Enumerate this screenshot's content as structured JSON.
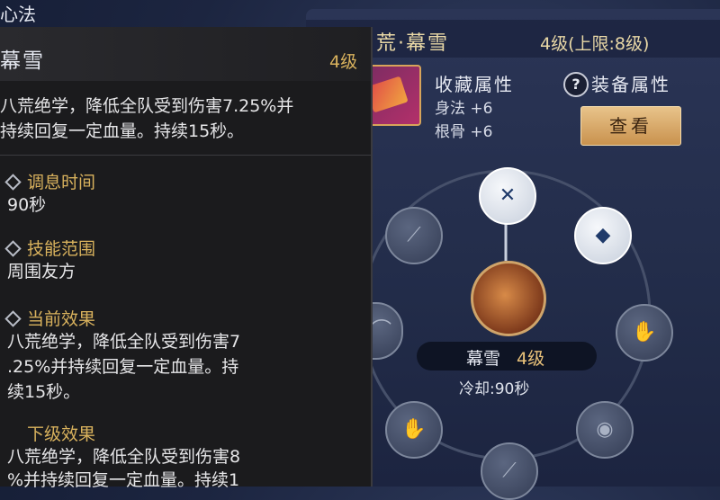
{
  "top_label": "心法",
  "tooltip": {
    "title": "幕雪",
    "level": "4级",
    "description_lines": [
      "八荒绝学，降低全队受到伤害7.25%并",
      "持续回复一定血量。持续15秒。"
    ],
    "sections": [
      {
        "label": "调息时间",
        "value_lines": [
          "90秒"
        ]
      },
      {
        "label": "技能范围",
        "value_lines": [
          "周围友方"
        ]
      },
      {
        "label": "当前效果",
        "value_lines": [
          "八荒绝学，降低全队受到伤害7",
          ".25%并持续回复一定血量。持",
          "续15秒。"
        ]
      },
      {
        "label": "下级效果",
        "value_lines": [
          "八荒绝学，降低全队受到伤害8",
          "%并持续回复一定血量。持续1"
        ]
      }
    ]
  },
  "panel": {
    "title": "荒·幕雪",
    "level": "4级(上限:8级)",
    "collect_title": "收藏属性",
    "stats": [
      "身法 +6",
      "根骨 +6"
    ],
    "help_icon": "?",
    "equip_title": "装备属性",
    "view_button": "查看"
  },
  "wheel": {
    "skill_name": "幕雪",
    "skill_level": "4级",
    "cooldown": "冷却:90秒"
  }
}
